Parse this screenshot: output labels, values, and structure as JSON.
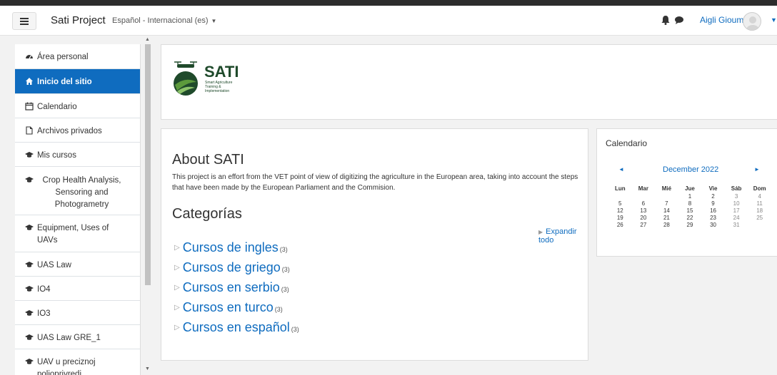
{
  "navbar": {
    "site_name": "Sati Project",
    "language": "Español - Internacional (es)",
    "user_name": "Aigli Gioumi"
  },
  "sidebar": {
    "items": [
      {
        "label": "Área personal",
        "icon": "dashboard-icon"
      },
      {
        "label": "Inicio del sitio",
        "icon": "home-icon",
        "active": true
      },
      {
        "label": "Calendario",
        "icon": "calendar-icon"
      },
      {
        "label": "Archivos privados",
        "icon": "file-icon"
      },
      {
        "label": "Mis cursos",
        "icon": "graduation-cap-icon"
      },
      {
        "label": "Crop Health Analysis, Sensoring and Photogrametry",
        "icon": "graduation-cap-icon"
      },
      {
        "label": "Equipment, Uses of UAVs",
        "icon": "graduation-cap-icon"
      },
      {
        "label": "UAS Law",
        "icon": "graduation-cap-icon"
      },
      {
        "label": "IO4",
        "icon": "graduation-cap-icon"
      },
      {
        "label": "IO3",
        "icon": "graduation-cap-icon"
      },
      {
        "label": "UAS Law GRE_1",
        "icon": "graduation-cap-icon"
      },
      {
        "label": "UAV u preciznoj poljoprivredi",
        "icon": "graduation-cap-icon"
      }
    ]
  },
  "logo": {
    "title": "SATI",
    "tagline": "Smart Agriculture Training & Implementation",
    "colors": {
      "dark_green": "#1f4a2b",
      "light_green": "#5c9a3c"
    }
  },
  "about": {
    "title": "About SATI",
    "text": "This project is an effort from the VET  point of view of digitizing the agriculture in the European area, taking into account the steps that have been made by the European Parliament and the Commision."
  },
  "categories": {
    "title": "Categorías",
    "expand_label": "Expandir todo",
    "items": [
      {
        "name": "Cursos de ingles",
        "count": "(3)"
      },
      {
        "name": "Cursos de griego",
        "count": "(3)"
      },
      {
        "name": "Cursos en serbio",
        "count": "(3)"
      },
      {
        "name": "Cursos en turco",
        "count": "(3)"
      },
      {
        "name": "Cursos en español",
        "count": "(3)"
      }
    ]
  },
  "calendar": {
    "title": "Calendario",
    "month": "December 2022",
    "weekdays": [
      "Lun",
      "Mar",
      "Mié",
      "Jue",
      "Vie",
      "Sáb",
      "Dom"
    ],
    "weeks": [
      [
        "",
        "",
        "",
        "1",
        "2",
        "3",
        "4"
      ],
      [
        "5",
        "6",
        "7",
        "8",
        "9",
        "10",
        "11"
      ],
      [
        "12",
        "13",
        "14",
        "15",
        "16",
        "17",
        "18"
      ],
      [
        "19",
        "20",
        "21",
        "22",
        "23",
        "24",
        "25"
      ],
      [
        "26",
        "27",
        "28",
        "29",
        "30",
        "31",
        ""
      ]
    ]
  },
  "colors": {
    "accent": "#0f6cbf",
    "topstrip": "#2c2c2c"
  }
}
